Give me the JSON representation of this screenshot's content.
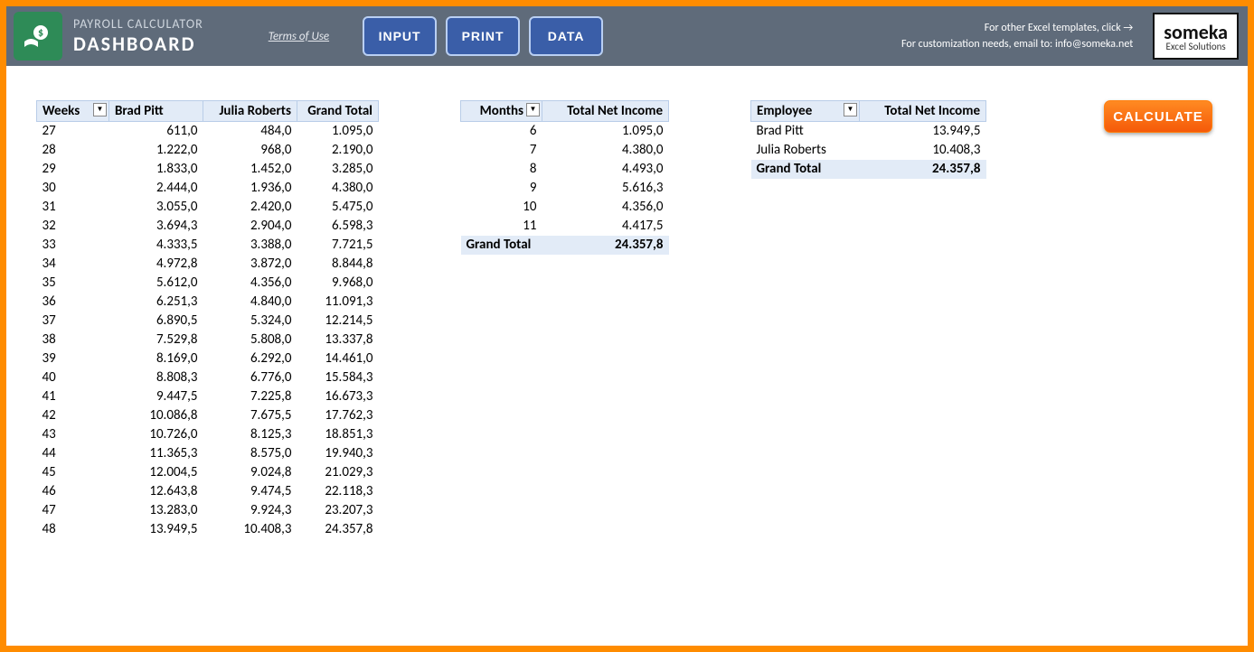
{
  "header": {
    "app_title": "PAYROLL CALCULATOR",
    "subtitle": "DASHBOARD",
    "terms": "Terms of Use",
    "nav": {
      "input": "INPUT",
      "print": "PRINT",
      "data": "DATA"
    },
    "promo_line1": "For other Excel templates, click →",
    "promo_line2": "For customization needs, email to: info@someka.net",
    "brand_top": "someka",
    "brand_sub": "Excel Solutions"
  },
  "weeks_table": {
    "headers": {
      "weeks": "Weeks",
      "brad": "Brad Pitt",
      "julia": "Julia Roberts",
      "gt": "Grand Total"
    },
    "rows": [
      {
        "w": "27",
        "b": "611,0",
        "j": "484,0",
        "g": "1.095,0"
      },
      {
        "w": "28",
        "b": "1.222,0",
        "j": "968,0",
        "g": "2.190,0"
      },
      {
        "w": "29",
        "b": "1.833,0",
        "j": "1.452,0",
        "g": "3.285,0"
      },
      {
        "w": "30",
        "b": "2.444,0",
        "j": "1.936,0",
        "g": "4.380,0"
      },
      {
        "w": "31",
        "b": "3.055,0",
        "j": "2.420,0",
        "g": "5.475,0"
      },
      {
        "w": "32",
        "b": "3.694,3",
        "j": "2.904,0",
        "g": "6.598,3"
      },
      {
        "w": "33",
        "b": "4.333,5",
        "j": "3.388,0",
        "g": "7.721,5"
      },
      {
        "w": "34",
        "b": "4.972,8",
        "j": "3.872,0",
        "g": "8.844,8"
      },
      {
        "w": "35",
        "b": "5.612,0",
        "j": "4.356,0",
        "g": "9.968,0"
      },
      {
        "w": "36",
        "b": "6.251,3",
        "j": "4.840,0",
        "g": "11.091,3"
      },
      {
        "w": "37",
        "b": "6.890,5",
        "j": "5.324,0",
        "g": "12.214,5"
      },
      {
        "w": "38",
        "b": "7.529,8",
        "j": "5.808,0",
        "g": "13.337,8"
      },
      {
        "w": "39",
        "b": "8.169,0",
        "j": "6.292,0",
        "g": "14.461,0"
      },
      {
        "w": "40",
        "b": "8.808,3",
        "j": "6.776,0",
        "g": "15.584,3"
      },
      {
        "w": "41",
        "b": "9.447,5",
        "j": "7.225,8",
        "g": "16.673,3"
      },
      {
        "w": "42",
        "b": "10.086,8",
        "j": "7.675,5",
        "g": "17.762,3"
      },
      {
        "w": "43",
        "b": "10.726,0",
        "j": "8.125,3",
        "g": "18.851,3"
      },
      {
        "w": "44",
        "b": "11.365,3",
        "j": "8.575,0",
        "g": "19.940,3"
      },
      {
        "w": "45",
        "b": "12.004,5",
        "j": "9.024,8",
        "g": "21.029,3"
      },
      {
        "w": "46",
        "b": "12.643,8",
        "j": "9.474,5",
        "g": "22.118,3"
      },
      {
        "w": "47",
        "b": "13.283,0",
        "j": "9.924,3",
        "g": "23.207,3"
      },
      {
        "w": "48",
        "b": "13.949,5",
        "j": "10.408,3",
        "g": "24.357,8"
      }
    ]
  },
  "months_table": {
    "headers": {
      "months": "Months",
      "tni": "Total Net Income"
    },
    "rows": [
      {
        "m": "6",
        "v": "1.095,0"
      },
      {
        "m": "7",
        "v": "4.380,0"
      },
      {
        "m": "8",
        "v": "4.493,0"
      },
      {
        "m": "9",
        "v": "5.616,3"
      },
      {
        "m": "10",
        "v": "4.356,0"
      },
      {
        "m": "11",
        "v": "4.417,5"
      }
    ],
    "total_label": "Grand Total",
    "total_value": "24.357,8"
  },
  "employee_table": {
    "headers": {
      "emp": "Employee",
      "tni": "Total Net Income"
    },
    "rows": [
      {
        "e": "Brad Pitt",
        "v": "13.949,5"
      },
      {
        "e": "Julia Roberts",
        "v": "10.408,3"
      }
    ],
    "total_label": "Grand Total",
    "total_value": "24.357,8"
  },
  "calculate_label": "CALCULATE"
}
